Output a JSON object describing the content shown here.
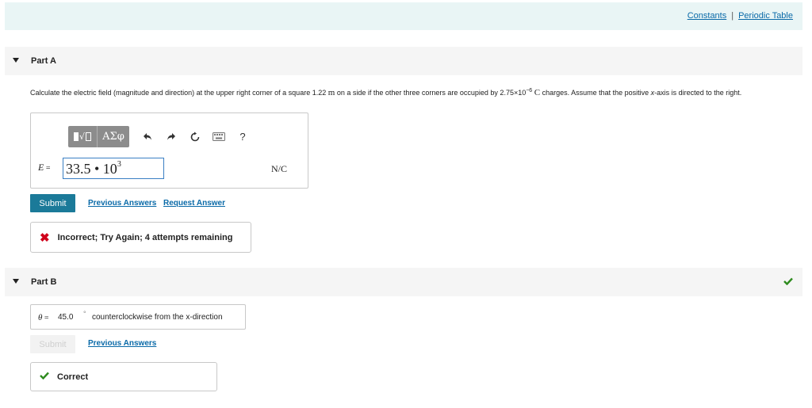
{
  "header": {
    "constants_link": "Constants",
    "separator": "|",
    "periodic_table_link": "Periodic Table"
  },
  "part_a": {
    "title": "Part A",
    "question": {
      "text1": "Calculate the electric field (magnitude and direction) at the upper right corner of a square 1.22",
      "unit_m": "m",
      "text2": "on a side if the other three corners are occupied by 2.75×10",
      "exponent": "−6",
      "unit_c": "C",
      "text3": "charges. Assume that the positive",
      "x_axis": "x",
      "text4": "-axis is directed to the right."
    },
    "toolbar": {
      "templates_icon": "templates-icon",
      "symbols_label": "ΑΣφ",
      "undo_icon": "undo-icon",
      "redo_icon": "redo-icon",
      "reset_icon": "reset-icon",
      "keyboard_icon": "keyboard-icon",
      "help_label": "?"
    },
    "variable_label": "E",
    "equals": " =",
    "input_mantissa": "33.5 • 10",
    "input_exponent": "3",
    "unit": "N/C",
    "submit_label": "Submit",
    "previous_answers": "Previous Answers",
    "request_answer": "Request Answer",
    "feedback": "Incorrect; Try Again; 4 attempts remaining",
    "feedback_color": "#d0021b"
  },
  "part_b": {
    "title": "Part B",
    "status_icon": "check-icon",
    "variable_label": "θ",
    "equals": " =",
    "value": "45.0",
    "degree": "°",
    "description": "counterclockwise from the x-direction",
    "submit_label": "Submit",
    "previous_answers": "Previous Answers",
    "feedback": "Correct",
    "feedback_color": "#2e8b1e"
  },
  "colors": {
    "accent": "#1b7a99",
    "link": "#0a6aa8",
    "header_bg": "#e9f5f5",
    "part_bg": "#f5f5f5"
  }
}
